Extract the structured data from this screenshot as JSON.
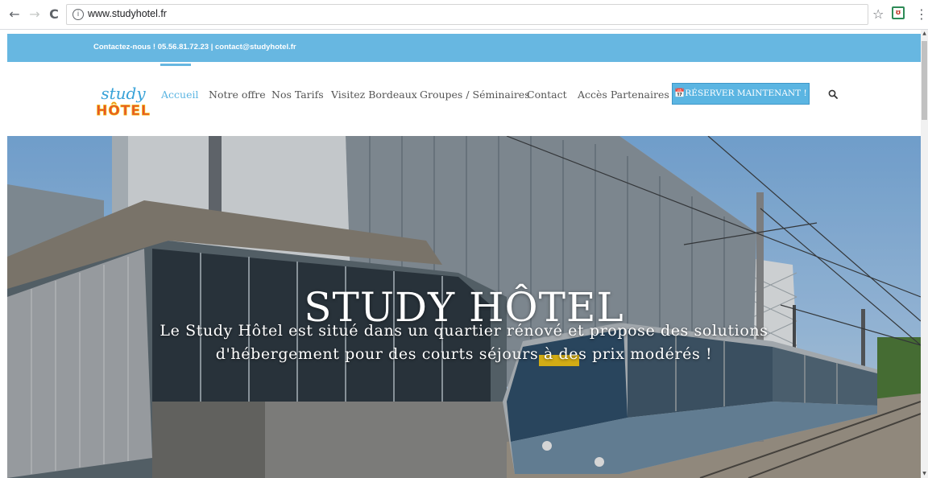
{
  "browser": {
    "back_glyph": "←",
    "forward_glyph": "→",
    "reload_glyph": "C",
    "info_glyph": "i",
    "url": "www.studyhotel.fr",
    "star_glyph": "☆",
    "menu_glyph": "⋮",
    "icons": [
      "back-arrow-icon",
      "forward-arrow-icon",
      "reload-icon",
      "info-icon",
      "bookmark-star-icon",
      "extension-icon",
      "menu-dots-icon"
    ]
  },
  "topbar": {
    "contact_text": "Contactez-nous ! 05.56.81.72.23  |  contact@studyhotel.fr"
  },
  "header": {
    "logo": {
      "line1": "study",
      "line2": "HÔTEL"
    },
    "nav": [
      {
        "label": "Accueil",
        "active": true
      },
      {
        "label": "Notre offre",
        "active": false
      },
      {
        "label": "Nos Tarifs",
        "active": false
      },
      {
        "label": "Visitez Bordeaux",
        "active": false
      },
      {
        "label": "Groupes / Séminaires",
        "active": false
      },
      {
        "label": "Contact",
        "active": false
      },
      {
        "label": "Accès Partenaires",
        "active": false
      }
    ],
    "reserve_button": "📅RÉSERVER MAINTENANT !",
    "search_icon": "search-icon"
  },
  "hero": {
    "title": "STUDY HÔTEL",
    "description_line1": "Le Study Hôtel est situé dans un quartier rénové et propose des solutions",
    "description_line2": "d'hébergement pour des courts séjours à des prix modérés !"
  },
  "colors": {
    "accent": "#67b7e1",
    "button": "#5bb5e2",
    "nav_text": "#555555"
  }
}
